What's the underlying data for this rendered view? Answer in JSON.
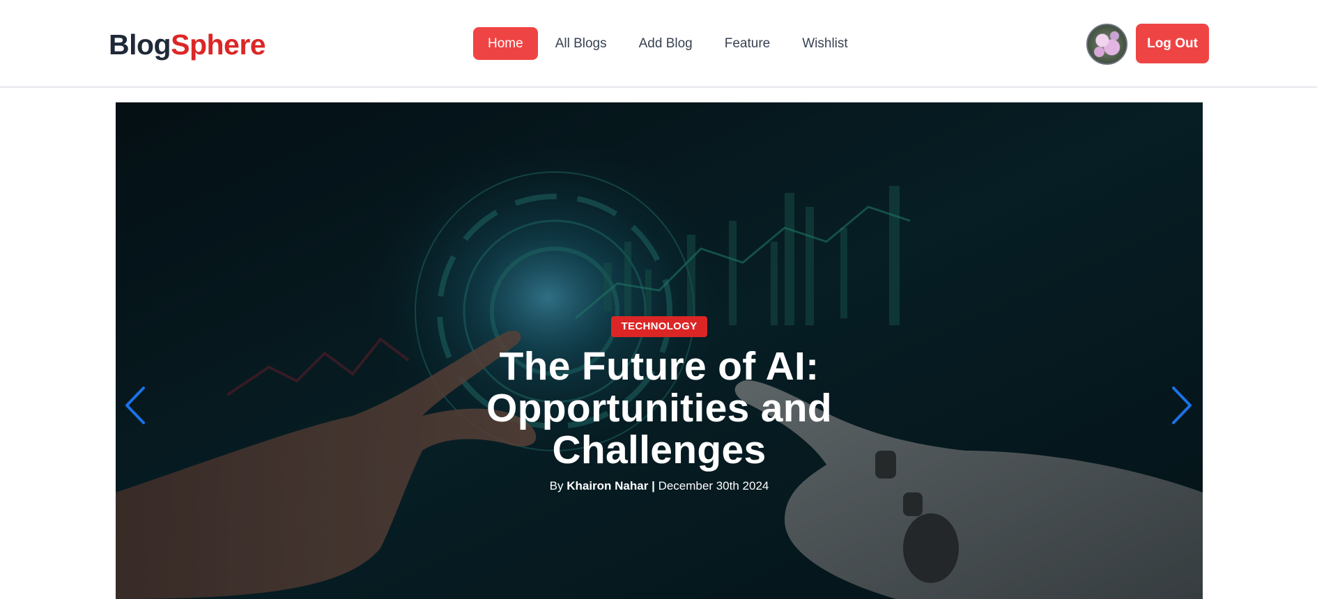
{
  "brand": {
    "part1": "Blog",
    "part2": "Sphere",
    "accent_color": "#dc2626"
  },
  "nav": {
    "items": [
      {
        "label": "Home",
        "active": true
      },
      {
        "label": "All Blogs",
        "active": false
      },
      {
        "label": "Add Blog",
        "active": false
      },
      {
        "label": "Feature",
        "active": false
      },
      {
        "label": "Wishlist",
        "active": false
      }
    ]
  },
  "header": {
    "avatar_icon": "user-avatar-flowers",
    "logout_label": "Log Out"
  },
  "hero": {
    "category": "TECHNOLOGY",
    "title": "The Future of AI: Opportunities and Challenges",
    "by_prefix": "By",
    "author": "Khairon Nahar",
    "separator": "|",
    "date": "December 30th 2024",
    "prev_icon": "chevron-left-icon",
    "next_icon": "chevron-right-icon",
    "arrow_color": "#1a73e8"
  },
  "colors": {
    "primary_button": "#ef4444",
    "badge": "#dc2626",
    "hero_bg": "#061c24"
  }
}
